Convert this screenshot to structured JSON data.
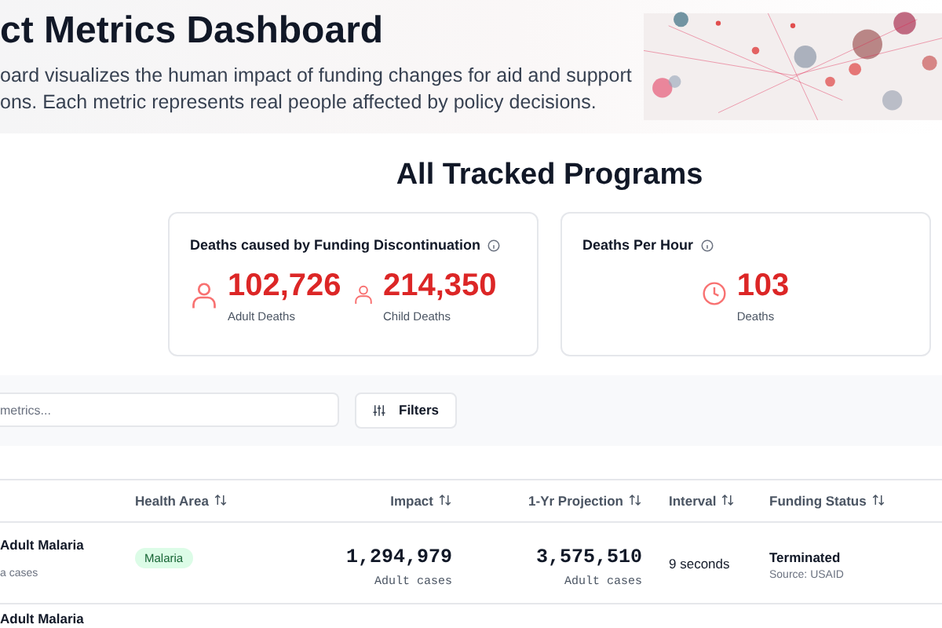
{
  "header": {
    "title": "ct Metrics Dashboard",
    "description_lines": [
      "oard visualizes the human impact of funding changes for aid and support",
      "ons. Each metric represents real people affected by policy decisions."
    ]
  },
  "section_title": "All Tracked Programs",
  "cards": [
    {
      "title": "Deaths caused by Funding Discontinuation",
      "metrics": [
        {
          "kind": "adult",
          "value": "102,726",
          "label": "Adult Deaths"
        },
        {
          "kind": "child",
          "value": "214,350",
          "label": "Child Deaths"
        }
      ]
    },
    {
      "title": "Deaths Per Hour",
      "metrics": [
        {
          "kind": "clock",
          "value": "103",
          "label": "Deaths"
        }
      ]
    }
  ],
  "search": {
    "placeholder": "metrics..."
  },
  "filter_button": "Filters",
  "table": {
    "columns": [
      "Health Area",
      "Impact",
      "1-Yr Projection",
      "Interval",
      "Funding Status"
    ],
    "rows": [
      {
        "program": "Adult Malaria",
        "program_sub": "a cases",
        "health_area": "Malaria",
        "impact": "1,294,979",
        "impact_unit": "Adult cases",
        "projection": "3,575,510",
        "projection_unit": "Adult cases",
        "interval": "9 seconds",
        "status": "Terminated",
        "source": "Source: USAID"
      },
      {
        "program": "Adult Malaria"
      }
    ]
  }
}
